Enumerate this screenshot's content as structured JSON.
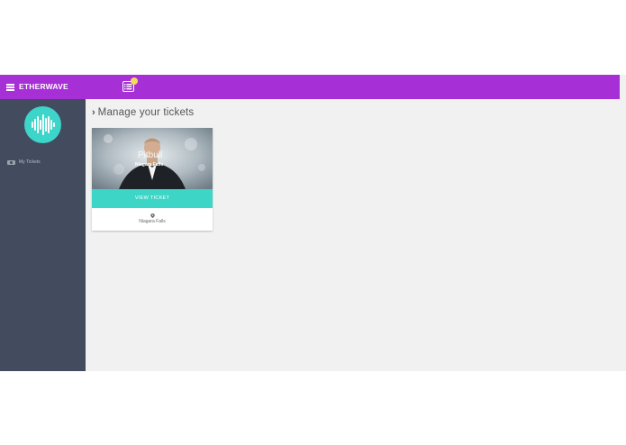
{
  "header": {
    "brand": "ETHERWAVE",
    "accent_color": "#a62fd6",
    "notification_color": "#f1dc57"
  },
  "sidebar": {
    "logo_color": "#3dd4c9",
    "items": [
      {
        "label": "My Tickets",
        "icon": "ticket-icon"
      }
    ]
  },
  "main": {
    "heading": "Manage your tickets",
    "tickets": [
      {
        "title": "Pitbull",
        "location_overlay": "Niagara Falls",
        "button_label": "VIEW TICKET",
        "venue": "Niagara Falls",
        "button_color": "#3dd6c6"
      }
    ]
  }
}
